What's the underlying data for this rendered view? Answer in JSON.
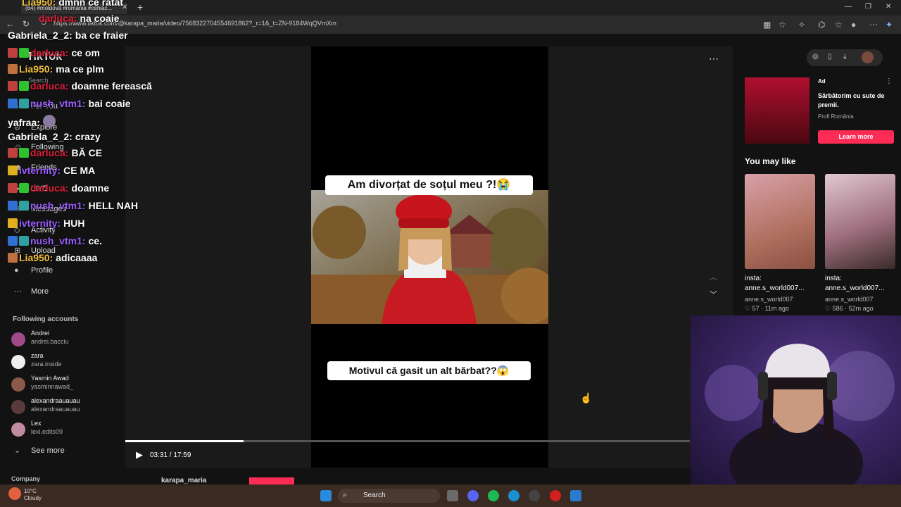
{
  "browser": {
    "tab_title": "(64) #moldova #romania #cehiac...",
    "url": "https://www.tiktok.com/@karapa_maria/video/7568322704554691862?_r=1&_t=ZN-9184WqQVmXm"
  },
  "sidebar": {
    "logo": "TikTok",
    "search_placeholder": "Search",
    "items": [
      {
        "label": "For You"
      },
      {
        "label": "Explore"
      },
      {
        "label": "Following"
      },
      {
        "label": "Friends"
      },
      {
        "label": "LIVE"
      },
      {
        "label": "Messages"
      },
      {
        "label": "Activity"
      },
      {
        "label": "Upload"
      },
      {
        "label": "Profile"
      },
      {
        "label": "More"
      }
    ],
    "following_heading": "Following accounts",
    "accounts": [
      {
        "name": "Andrei",
        "handle": "andrei.bacciu"
      },
      {
        "name": "zara",
        "handle": "zara.inside"
      },
      {
        "name": "Yasmin Awad",
        "handle": "yasminnawad_"
      },
      {
        "name": "alexandraauauau",
        "handle": "alexandraauauau"
      },
      {
        "name": "Lex",
        "handle": "lexi.edits09"
      }
    ],
    "see_more": "See more",
    "company": "Company"
  },
  "video": {
    "caption_top": "Am divorțat de soțul meu ?!😭",
    "caption_bottom": "Motivul că gasit un alt bărbat??😱",
    "time": "03:31 / 17:59",
    "progress": 0.21,
    "channel": "karapa_maria"
  },
  "ad": {
    "label": "Ad",
    "title": "Sărbătorim cu sute de premii.",
    "brand": "Profi România",
    "cta": "Learn more"
  },
  "suggestions": {
    "heading": "You may like",
    "items": [
      {
        "line1": "insta:",
        "line2": "anne.s_world007...",
        "handle": "anne.s_world007",
        "stats": "♡ 57 · 11m ago"
      },
      {
        "line1": "insta:",
        "line2": "anne.s_world007...",
        "handle": "anne.s_world007",
        "stats": "♡ 586 · 52m ago"
      }
    ]
  },
  "chat": [
    {
      "user": "Lia950:",
      "msg": "dmnn ce ratat",
      "color": "#f0c040"
    },
    {
      "user": "darluca:",
      "msg": "na coaie",
      "color": "#e0203a"
    },
    {
      "user": "Gabriela_2_2:",
      "msg": "ba ce fraier",
      "color": "#ffffff"
    },
    {
      "user": "darluca:",
      "msg": "ce om",
      "color": "#e0203a"
    },
    {
      "user": "Lia950:",
      "msg": "ma ce plm",
      "color": "#f0c040"
    },
    {
      "user": "darluca:",
      "msg": "doamne ferească",
      "color": "#e0203a"
    },
    {
      "user": "nush_vtm1:",
      "msg": "bai coaie",
      "color": "#9b5cff"
    },
    {
      "user": "yafraa:",
      "msg": "",
      "color": "#ffffff"
    },
    {
      "user": "Gabriela_2_2:",
      "msg": "crazy",
      "color": "#ffffff"
    },
    {
      "user": "darluca:",
      "msg": "BĂ CE",
      "color": "#e0203a"
    },
    {
      "user": "ivternity:",
      "msg": "CE MA",
      "color": "#9b5cff"
    },
    {
      "user": "darluca:",
      "msg": "doamne",
      "color": "#e0203a"
    },
    {
      "user": "nush_vtm1:",
      "msg": "HELL NAH",
      "color": "#9b5cff"
    },
    {
      "user": "ivternity:",
      "msg": "HUH",
      "color": "#9b5cff"
    },
    {
      "user": "nush_vtm1:",
      "msg": "ce.",
      "color": "#9b5cff"
    },
    {
      "user": "Lia950:",
      "msg": "adicaaaa",
      "color": "#f0c040"
    }
  ],
  "taskbar": {
    "weather_temp": "10°C",
    "weather_desc": "Cloudy",
    "search": "Search"
  },
  "colors": {
    "accent": "#fe2c55",
    "background": "#121212"
  }
}
